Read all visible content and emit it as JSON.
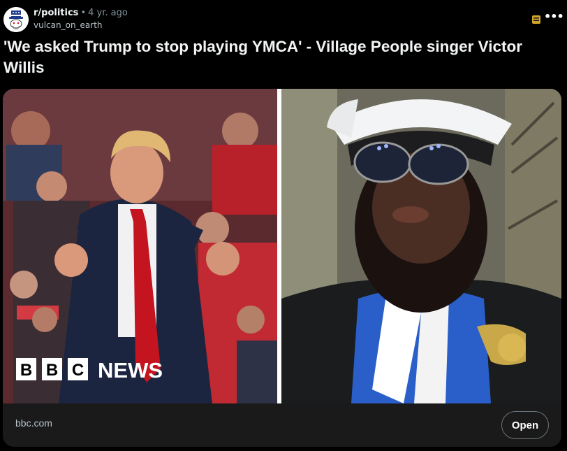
{
  "post": {
    "subreddit": "r/politics",
    "separator": "•",
    "age": "4 yr. ago",
    "author": "vulcan_on_earth",
    "title": "'We asked Trump to stop playing YMCA' - Village People singer Victor Willis"
  },
  "icons": {
    "avatar": "snoo-uncle-sam-icon",
    "moderation": "mod-shield-icon",
    "more": "more-options-icon"
  },
  "card": {
    "image_watermark": {
      "letters": [
        "B",
        "B",
        "C"
      ],
      "word": "NEWS"
    },
    "domain": "bbc.com",
    "open_label": "Open"
  },
  "colors": {
    "background": "#000000",
    "card": "#1a1a1b",
    "title": "#f2f4f5",
    "muted": "#82959b",
    "mod_icon": "#d4a72c"
  }
}
